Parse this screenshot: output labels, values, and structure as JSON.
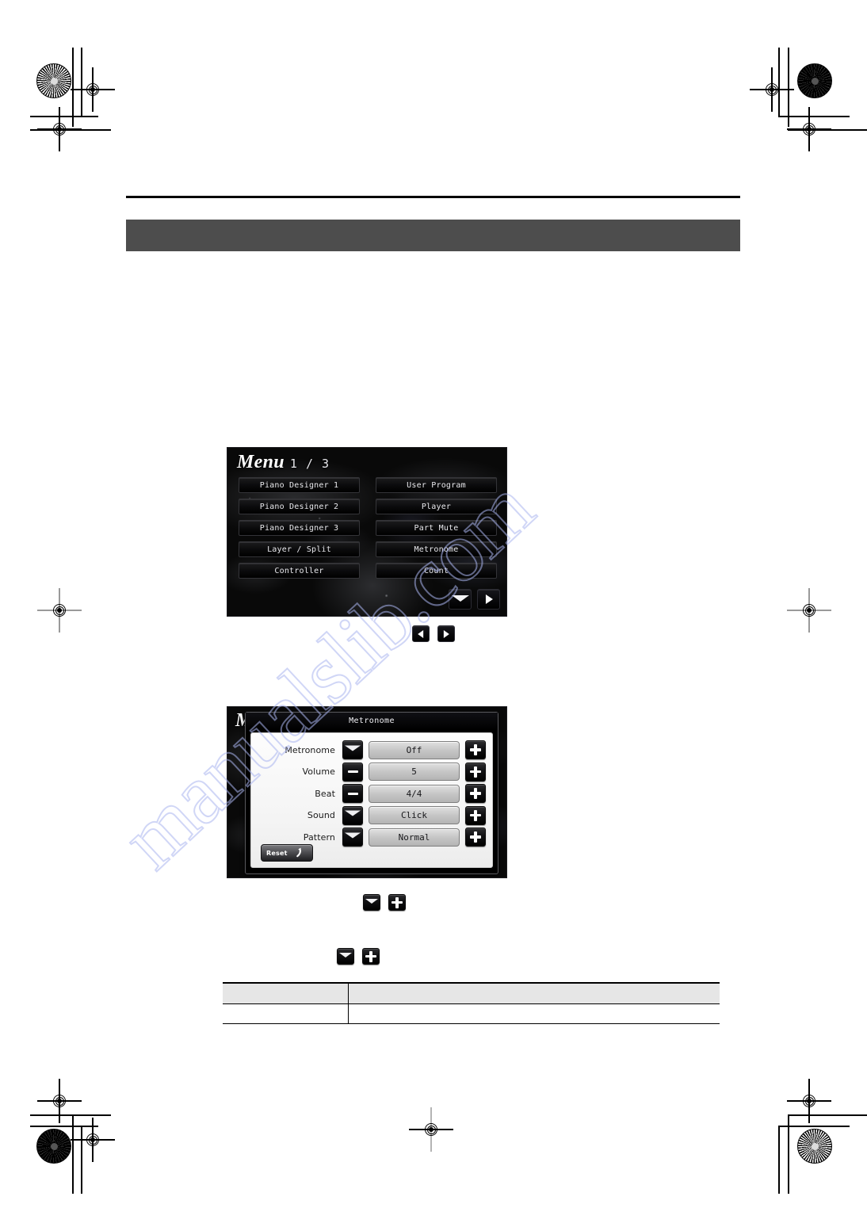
{
  "page": {
    "watermark": "manualslib.com",
    "band_color": "#4d4d4d"
  },
  "menu_screen": {
    "title_word": "Menu",
    "page_indicator": "1 / 3",
    "buttons": [
      {
        "label": "Piano Designer 1"
      },
      {
        "label": "User Program"
      },
      {
        "label": "Piano Designer 2"
      },
      {
        "label": "Player"
      },
      {
        "label": "Piano Designer 3"
      },
      {
        "label": "Part Mute"
      },
      {
        "label": "Layer / Split"
      },
      {
        "label": "Metronome"
      },
      {
        "label": "Controller"
      },
      {
        "label": "Count"
      }
    ],
    "nav": {
      "down_icon": "chevron-down-icon",
      "next_icon": "triangle-right-icon"
    }
  },
  "page_arrows": {
    "prev_icon": "triangle-left-icon",
    "next_icon": "triangle-right-icon"
  },
  "metronome_screen": {
    "ghost_title": "M",
    "dialog": {
      "title": "Metronome",
      "rows": [
        {
          "label": "Metronome",
          "value": "Off",
          "minus_style": "wedge",
          "plus": "+"
        },
        {
          "label": "Volume",
          "value": "5",
          "minus_style": "flat",
          "plus": "+"
        },
        {
          "label": "Beat",
          "value": "4/4",
          "minus_style": "flat",
          "plus": "+"
        },
        {
          "label": "Sound",
          "value": "Click",
          "minus_style": "wedge",
          "plus": "+"
        },
        {
          "label": "Pattern",
          "value": "Normal",
          "minus_style": "wedge",
          "plus": "+"
        }
      ],
      "reset": {
        "label": "Reset",
        "icon": "curved-arrow-icon"
      }
    }
  },
  "inline_icons": {
    "volume_pair": {
      "minus_icon": "minus-button-icon",
      "plus_icon": "plus-button-icon"
    },
    "beat_pair": {
      "minus_icon": "minus-button-icon",
      "plus_icon": "plus-button-icon"
    }
  },
  "spec_table": {
    "headers": [
      "",
      ""
    ],
    "rows": [
      [
        "",
        ""
      ]
    ]
  }
}
